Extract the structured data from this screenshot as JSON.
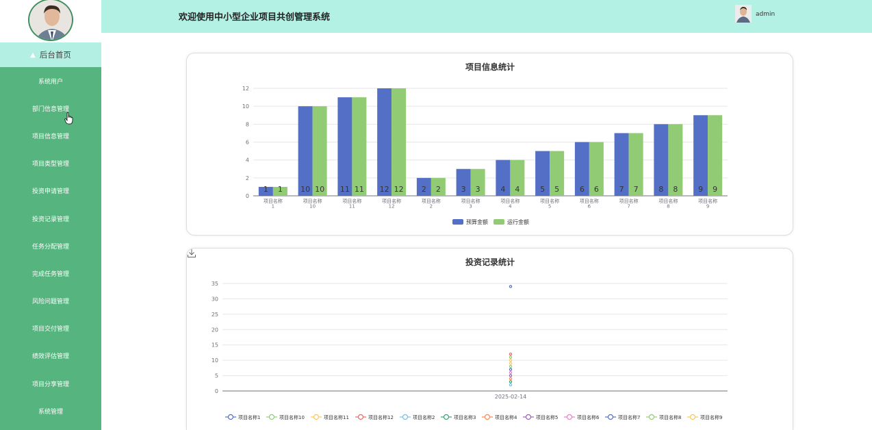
{
  "header": {
    "title": "欢迎使用中小型企业项目共创管理系统",
    "username": "admin"
  },
  "sidebar": {
    "home_label": "后台首页",
    "items": [
      {
        "label": "系统用户"
      },
      {
        "label": "部门信息管理"
      },
      {
        "label": "项目信息管理"
      },
      {
        "label": "项目类型管理"
      },
      {
        "label": "投资申请管理"
      },
      {
        "label": "投资记录管理"
      },
      {
        "label": "任务分配管理"
      },
      {
        "label": "完成任务管理"
      },
      {
        "label": "风险问题管理"
      },
      {
        "label": "项目交付管理"
      },
      {
        "label": "绩效评估管理"
      },
      {
        "label": "项目分享管理"
      },
      {
        "label": "系统管理"
      }
    ]
  },
  "chart_data": [
    {
      "type": "bar",
      "title": "项目信息统计",
      "categories": [
        "项目名称\n1",
        "项目名称\n10",
        "项目名称\n11",
        "项目名称\n12",
        "项目名称\n2",
        "项目名称\n3",
        "项目名称\n4",
        "项目名称\n5",
        "项目名称\n6",
        "项目名称\n7",
        "项目名称\n8",
        "项目名称\n9"
      ],
      "series": [
        {
          "name": "预算金额",
          "color": "#5470c6",
          "values": [
            1,
            10,
            11,
            12,
            2,
            3,
            4,
            5,
            6,
            7,
            8,
            9
          ]
        },
        {
          "name": "运行金额",
          "color": "#91cc75",
          "values": [
            1,
            10,
            11,
            12,
            2,
            3,
            4,
            5,
            6,
            7,
            8,
            9
          ]
        }
      ],
      "ylim": [
        0,
        12
      ],
      "yticks": [
        0,
        2,
        4,
        6,
        8,
        10,
        12
      ],
      "legend_position": "bottom",
      "grid": true
    },
    {
      "type": "line",
      "title": "投资记录统计",
      "x": [
        "2025-02-14"
      ],
      "series": [
        {
          "name": "项目名称1",
          "color": "#5470c6",
          "values": [
            34
          ]
        },
        {
          "name": "项目名称10",
          "color": "#91cc75",
          "values": [
            11
          ]
        },
        {
          "name": "项目名称11",
          "color": "#fac858",
          "values": [
            10
          ]
        },
        {
          "name": "项目名称12",
          "color": "#ee6666",
          "values": [
            12
          ]
        },
        {
          "name": "项目名称2",
          "color": "#73c0de",
          "values": [
            2
          ]
        },
        {
          "name": "项目名称3",
          "color": "#3ba272",
          "values": [
            3
          ]
        },
        {
          "name": "项目名称4",
          "color": "#fc8452",
          "values": [
            4
          ]
        },
        {
          "name": "项目名称5",
          "color": "#9a60b4",
          "values": [
            5
          ]
        },
        {
          "name": "项目名称6",
          "color": "#ea7ccc",
          "values": [
            6
          ]
        },
        {
          "name": "项目名称7",
          "color": "#5470c6",
          "values": [
            7
          ]
        },
        {
          "name": "项目名称8",
          "color": "#91cc75",
          "values": [
            8
          ]
        },
        {
          "name": "项目名称9",
          "color": "#fac858",
          "values": [
            9
          ]
        }
      ],
      "ylim": [
        0,
        35
      ],
      "yticks": [
        0,
        5,
        10,
        15,
        20,
        25,
        30,
        35
      ],
      "legend_position": "bottom",
      "grid": true
    }
  ]
}
